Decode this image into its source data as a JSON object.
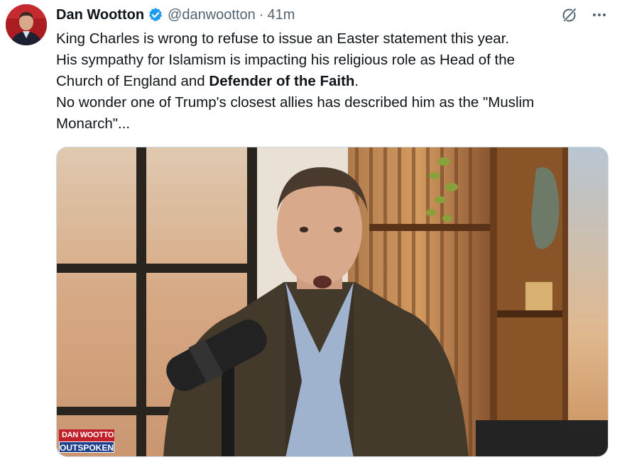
{
  "author": {
    "name": "Dan Wootton",
    "handle": "@danwootton",
    "separator": "·",
    "time": "41m",
    "verified": true,
    "verified_color": "#1d9bf0"
  },
  "icons": {
    "grok": "grok-slash-icon",
    "more": "more-dots-icon"
  },
  "tweet": {
    "line1": "King Charles is wrong to refuse to issue an Easter statement this year.",
    "line2": "His sympathy for Islamism is impacting his religious role as Head of the",
    "line3_before": "Church of England and ",
    "line3_bold": "Defender of the Faith",
    "line3_after": ".",
    "line4": "No wonder one of Trump's closest allies has described him as the \"Muslim",
    "line5": "Monarch\"..."
  },
  "media": {
    "logo_top": "DAN WOOTTON",
    "logo_bottom": "OUTSPOKEN"
  },
  "colors": {
    "text": "#0f1419",
    "secondary": "#536471",
    "border": "#cfd9de"
  }
}
